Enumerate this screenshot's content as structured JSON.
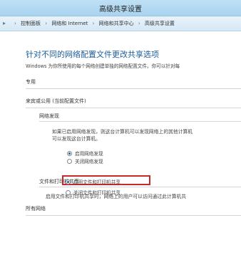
{
  "window": {
    "title": "高级共享设置"
  },
  "address_bar": {
    "crumbs": [
      "控制面板",
      "网络和 Internet",
      "网络和共享中心",
      "高级共享设置"
    ]
  },
  "main": {
    "heading": "针对不同的网络配置文件更改共享选项",
    "description": "Windows 为你所使用的每个网络创建单独的网络配置文件。你可以针对每",
    "profiles": {
      "private": "专用",
      "guest_public": "来宾或公用 (当前配置文件)",
      "all_networks": "所有网络"
    },
    "network_discovery": {
      "title": "网络发现",
      "description_line1": "如果已启用网络发现，则这台计算机可以发现网络上的其他计算机",
      "description_line2": "可以发现这台计算机。",
      "options": [
        "启用网络发现",
        "关闭网络发现"
      ],
      "selected": "启用网络发现"
    },
    "file_printer_sharing": {
      "title": "文件和打印机共享",
      "description": "启用文件和打印机共享时，网络上的用户可以访问通过此计算机共",
      "options": [
        "启用文件和打印机共享",
        "关闭文件和打印机共享"
      ],
      "selected": "启用文件和打印机共享"
    }
  },
  "colors": {
    "heading": "#1b5c9c",
    "highlight_box": "#c42a2a",
    "titlebar": "#bfe0f5"
  },
  "icons": {
    "address_nav": "network-folder-icon",
    "breadcrumb_separator": "chevron-right-icon"
  }
}
